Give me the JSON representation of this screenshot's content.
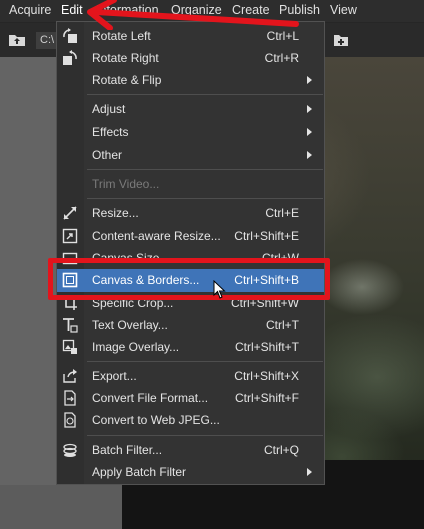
{
  "menubar": {
    "items": [
      "Acquire",
      "Edit",
      "Information",
      "Organize",
      "Create",
      "Publish",
      "View"
    ]
  },
  "toolbar": {
    "path_text": "C:\\"
  },
  "menu": {
    "items": [
      {
        "label": "Rotate Left",
        "shortcut": "Ctrl+L",
        "icon": "rotate-left-icon"
      },
      {
        "label": "Rotate Right",
        "shortcut": "Ctrl+R",
        "icon": "rotate-right-icon"
      },
      {
        "label": "Rotate & Flip",
        "submenu": true
      },
      {
        "label": "Adjust",
        "submenu": true
      },
      {
        "label": "Effects",
        "submenu": true
      },
      {
        "label": "Other",
        "submenu": true
      },
      {
        "label": "Trim Video...",
        "disabled": true
      },
      {
        "label": "Resize...",
        "shortcut": "Ctrl+E",
        "icon": "resize-icon"
      },
      {
        "label": "Content-aware Resize...",
        "shortcut": "Ctrl+Shift+E",
        "icon": "content-aware-resize-icon"
      },
      {
        "label": "Canvas Size...",
        "shortcut": "Ctrl+W",
        "icon": "canvas-size-icon"
      },
      {
        "label": "Canvas & Borders...",
        "shortcut": "Ctrl+Shift+B",
        "icon": "canvas-borders-icon",
        "highlighted": true
      },
      {
        "label": "Specific Crop...",
        "shortcut": "Ctrl+Shift+W",
        "icon": "crop-icon"
      },
      {
        "label": "Text Overlay...",
        "shortcut": "Ctrl+T",
        "icon": "text-overlay-icon"
      },
      {
        "label": "Image Overlay...",
        "shortcut": "Ctrl+Shift+T",
        "icon": "image-overlay-icon"
      },
      {
        "label": "Export...",
        "shortcut": "Ctrl+Shift+X",
        "icon": "export-icon"
      },
      {
        "label": "Convert File Format...",
        "shortcut": "Ctrl+Shift+F",
        "icon": "convert-format-icon"
      },
      {
        "label": "Convert to Web JPEG...",
        "icon": "web-jpeg-icon"
      },
      {
        "label": "Batch Filter...",
        "shortcut": "Ctrl+Q",
        "icon": "batch-filter-icon"
      },
      {
        "label": "Apply Batch Filter",
        "submenu": true
      }
    ]
  },
  "colors": {
    "highlight": "#3f74b8",
    "annotation": "#e3141c"
  }
}
